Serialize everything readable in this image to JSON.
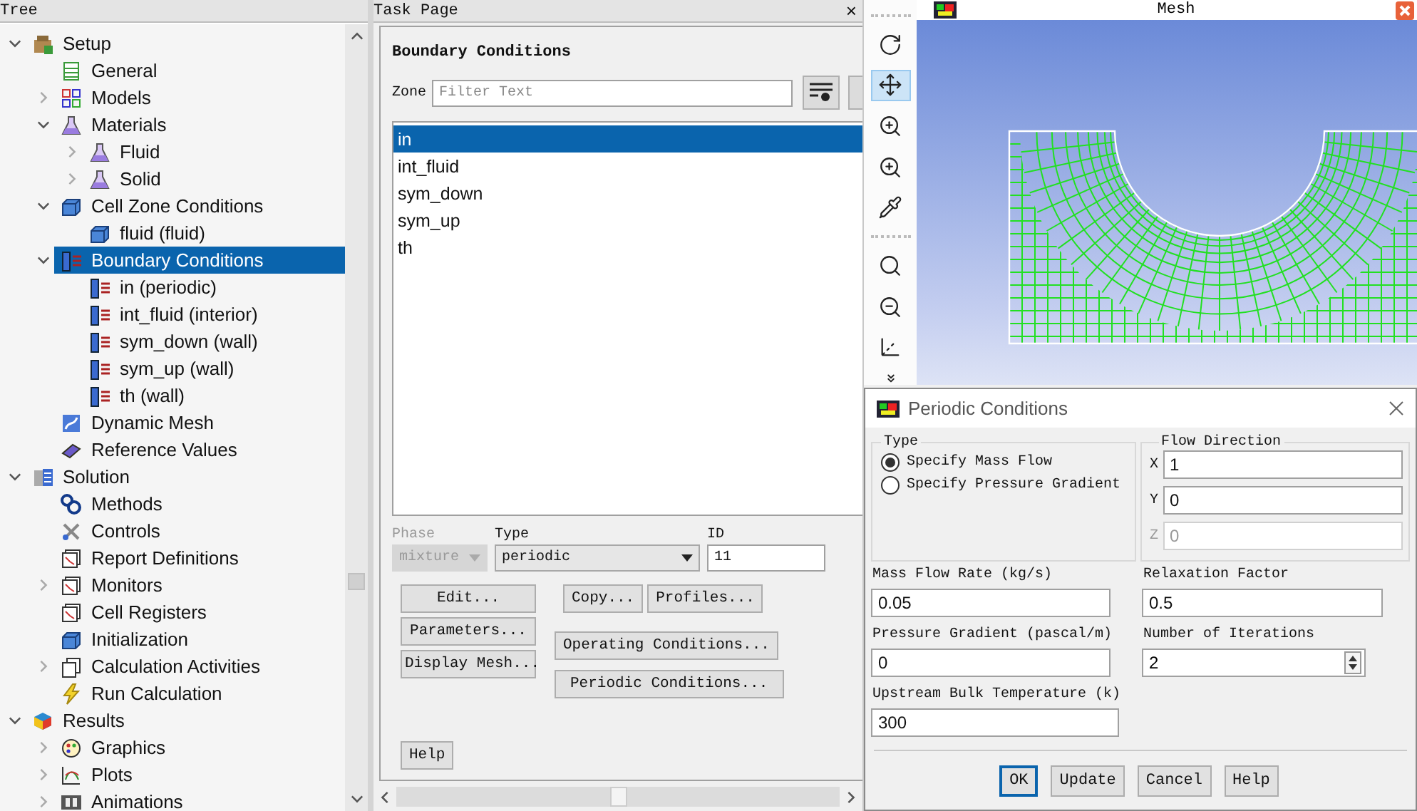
{
  "tree": {
    "title": "Tree",
    "items": [
      {
        "label": "Setup",
        "selected": false,
        "expanded": true,
        "children": [
          {
            "label": "General",
            "selected": false
          },
          {
            "label": "Models",
            "selected": false,
            "expanded": false
          },
          {
            "label": "Materials",
            "selected": false,
            "expanded": true,
            "children": [
              {
                "label": "Fluid",
                "selected": false,
                "expanded": false
              },
              {
                "label": "Solid",
                "selected": false,
                "expanded": false
              }
            ]
          },
          {
            "label": "Cell Zone Conditions",
            "selected": false,
            "expanded": true,
            "children": [
              {
                "label": "fluid (fluid)",
                "selected": false
              }
            ]
          },
          {
            "label": "Boundary Conditions",
            "selected": true,
            "expanded": true,
            "children": [
              {
                "label": "in (periodic)",
                "selected": false
              },
              {
                "label": "int_fluid (interior)",
                "selected": false
              },
              {
                "label": "sym_down (wall)",
                "selected": false
              },
              {
                "label": "sym_up (wall)",
                "selected": false
              },
              {
                "label": "th (wall)",
                "selected": false
              }
            ]
          },
          {
            "label": "Dynamic Mesh",
            "selected": false
          },
          {
            "label": "Reference Values",
            "selected": false
          }
        ]
      },
      {
        "label": "Solution",
        "selected": false,
        "expanded": true,
        "children": [
          {
            "label": "Methods",
            "selected": false
          },
          {
            "label": "Controls",
            "selected": false
          },
          {
            "label": "Report Definitions",
            "selected": false
          },
          {
            "label": "Monitors",
            "selected": false,
            "expanded": false
          },
          {
            "label": "Cell Registers",
            "selected": false
          },
          {
            "label": "Initialization",
            "selected": false
          },
          {
            "label": "Calculation Activities",
            "selected": false,
            "expanded": false
          },
          {
            "label": "Run Calculation",
            "selected": false
          }
        ]
      },
      {
        "label": "Results",
        "selected": false,
        "expanded": true,
        "children": [
          {
            "label": "Graphics",
            "selected": false,
            "expanded": false
          },
          {
            "label": "Plots",
            "selected": false,
            "expanded": false
          },
          {
            "label": "Animations",
            "selected": false,
            "expanded": false
          }
        ]
      }
    ]
  },
  "task_page": {
    "title": "Task Page",
    "close": "×",
    "heading": "Boundary Conditions",
    "zone_label": "Zone",
    "zone_filter": {
      "placeholder": "Filter Text"
    },
    "zones": [
      {
        "label": "in",
        "selected": true
      },
      {
        "label": "int_fluid",
        "selected": false
      },
      {
        "label": "sym_down",
        "selected": false
      },
      {
        "label": "sym_up",
        "selected": false
      },
      {
        "label": "th",
        "selected": false
      }
    ],
    "phase": {
      "label": "Phase",
      "value": "mixture",
      "disabled": true
    },
    "type": {
      "label": "Type",
      "value": "periodic"
    },
    "id": {
      "label": "ID",
      "value": "11"
    },
    "left_buttons": [
      "Edit...",
      "Parameters...",
      "Display Mesh..."
    ],
    "right_buttons": [
      [
        "Copy...",
        "Profiles..."
      ],
      [
        "Operating Conditions..."
      ],
      [
        "Periodic Conditions..."
      ]
    ],
    "help": "Help"
  },
  "toolbar": {
    "tools": [
      {
        "selected": false
      },
      {
        "selected": true
      },
      {
        "selected": false
      },
      {
        "selected": false
      },
      {
        "selected": false
      },
      {
        "selected": false
      },
      {
        "selected": false
      },
      {
        "selected": false
      }
    ]
  },
  "graphics": {
    "title": "Mesh"
  },
  "dialog": {
    "title": "Periodic Conditions",
    "type_group": {
      "label": "Type",
      "options": [
        {
          "label": "Specify Mass Flow",
          "selected": true
        },
        {
          "label": "Specify Pressure Gradient",
          "selected": false
        }
      ]
    },
    "flow_direction": {
      "label": "Flow Direction",
      "components": [
        {
          "axis": "X",
          "value": "1",
          "disabled": false
        },
        {
          "axis": "Y",
          "value": "0",
          "disabled": false
        },
        {
          "axis": "Z",
          "value": "0",
          "disabled": true
        }
      ]
    },
    "left_fields": [
      {
        "label": "Mass Flow Rate (kg/s)",
        "value": "0.05"
      },
      {
        "label": "Pressure Gradient (pascal/m)",
        "value": "0"
      },
      {
        "label": "Upstream Bulk Temperature (k)",
        "value": "300"
      }
    ],
    "right_fields": [
      {
        "kind": "text",
        "label": "Relaxation Factor",
        "value": "0.5"
      },
      {
        "kind": "spinner",
        "label": "Number of Iterations",
        "value": "2"
      }
    ],
    "buttons": [
      {
        "label": "OK",
        "focused": true
      },
      {
        "label": "Update",
        "focused": false
      },
      {
        "label": "Cancel",
        "focused": false
      },
      {
        "label": "Help",
        "focused": false
      }
    ]
  }
}
